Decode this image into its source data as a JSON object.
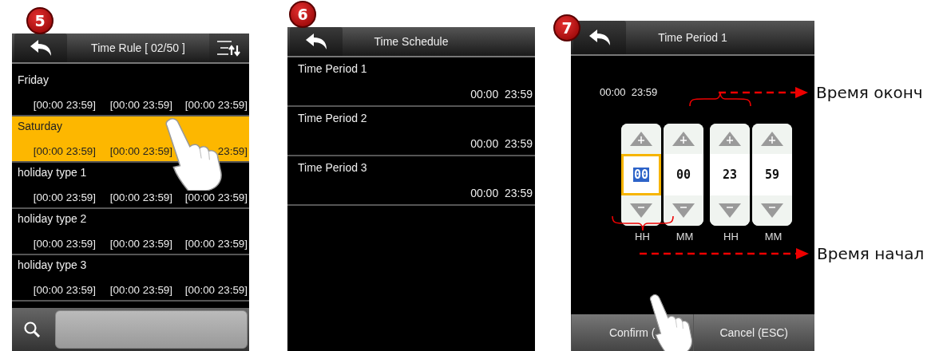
{
  "time_rule": {
    "step": "5",
    "title": "Time Rule [ 02/50 ]",
    "rows": [
      {
        "name": "Friday",
        "periods": [
          "[00:00 23:59]",
          "[00:00 23:59]",
          "[00:00 23:59]"
        ],
        "selected": false
      },
      {
        "name": "Saturday",
        "periods": [
          "[00:00 23:59]",
          "[00:00 23:59]",
          "23:59]"
        ],
        "selected": true
      },
      {
        "name": "holiday type 1",
        "periods": [
          "[00:00 23:59]",
          "[00:00 23:59]",
          "[00:00 23:59]"
        ],
        "selected": false
      },
      {
        "name": "holiday type 2",
        "periods": [
          "[00:00 23:59]",
          "[00:00 23:59]",
          "[00:00 23:59]"
        ],
        "selected": false
      },
      {
        "name": "holiday type 3",
        "periods": [
          "[00:00 23:59]",
          "[00:00 23:59]",
          "[00:00 23:59]"
        ],
        "selected": false
      }
    ]
  },
  "time_schedule": {
    "step": "6",
    "title": "Time Schedule",
    "periods": [
      {
        "name": "Time Period 1",
        "range": "00:00  23:59"
      },
      {
        "name": "Time Period 2",
        "range": "00:00  23:59"
      },
      {
        "name": "Time Period 3",
        "range": "00:00  23:59"
      }
    ]
  },
  "time_period": {
    "step": "7",
    "title": "Time Period 1",
    "summary": "00:00  23:59",
    "spinners": [
      {
        "value": "00",
        "unit": "HH",
        "selected": true
      },
      {
        "value": "00",
        "unit": "MM",
        "selected": false
      },
      {
        "value": "23",
        "unit": "HH",
        "selected": false
      },
      {
        "value": "59",
        "unit": "MM",
        "selected": false
      }
    ],
    "buttons": [
      "Confirm (",
      "Cancel (ESC)"
    ]
  },
  "annotations": [
    {
      "label": "Время оконч"
    },
    {
      "label": "Время начал"
    }
  ]
}
